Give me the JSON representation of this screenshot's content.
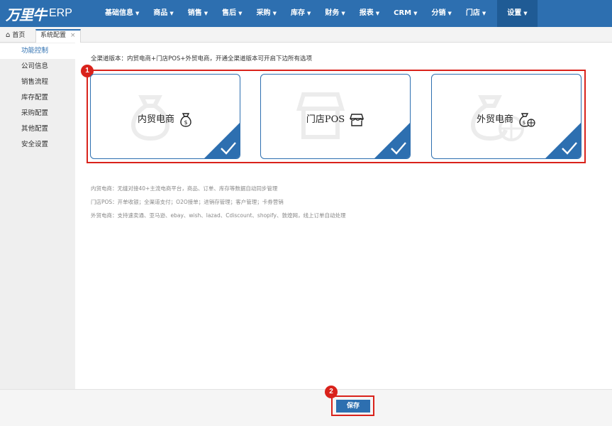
{
  "brand": {
    "logo_mark": "万里牛",
    "logo_text": "ERP"
  },
  "nav": [
    {
      "label": "基础信息",
      "active": false
    },
    {
      "label": "商品",
      "active": false
    },
    {
      "label": "销售",
      "active": false
    },
    {
      "label": "售后",
      "active": false
    },
    {
      "label": "采购",
      "active": false
    },
    {
      "label": "库存",
      "active": false
    },
    {
      "label": "财务",
      "active": false
    },
    {
      "label": "报表",
      "active": false
    },
    {
      "label": "CRM",
      "active": false
    },
    {
      "label": "分销",
      "active": false
    },
    {
      "label": "门店",
      "active": false
    },
    {
      "label": "设置",
      "active": true
    }
  ],
  "tabs": {
    "home": "首页",
    "system_config": "系统配置",
    "close_glyph": "×"
  },
  "sidebar": [
    {
      "label": "功能控制",
      "active": true
    },
    {
      "label": "公司信息",
      "active": false
    },
    {
      "label": "销售流程",
      "active": false
    },
    {
      "label": "库存配置",
      "active": false
    },
    {
      "label": "采购配置",
      "active": false
    },
    {
      "label": "其他配置",
      "active": false
    },
    {
      "label": "安全设置",
      "active": false
    }
  ],
  "intro": "全渠道版本：内贸电商+门店POS+外贸电商，开通全渠道版本可开启下边所有选项",
  "cards": [
    {
      "label": "内贸电商",
      "icon": "money-bag-icon",
      "checked": true
    },
    {
      "label": "门店POS",
      "icon": "storefront-icon",
      "checked": true
    },
    {
      "label": "外贸电商",
      "icon": "money-bag-globe-icon",
      "checked": true
    }
  ],
  "descriptions": [
    "内贸电商：无缝对接40+主流电商平台，商品、订单、库存等数据自动同步管理",
    "门店POS：开单收银；全渠道支付；O2O接单；进销存管理；客户管理；卡券营销",
    "外贸电商：支持速卖通、亚马逊、ebay、wish、lazad、Cdiscount、shopify、敦煌网，线上订单自动处理"
  ],
  "markers": {
    "first": "1",
    "second": "2"
  },
  "save_label": "保存",
  "colors": {
    "primary": "#2d6fb0",
    "nav_active": "#1f5b95",
    "highlight_red": "#d9221b",
    "sidebar_bg": "#efefef"
  }
}
